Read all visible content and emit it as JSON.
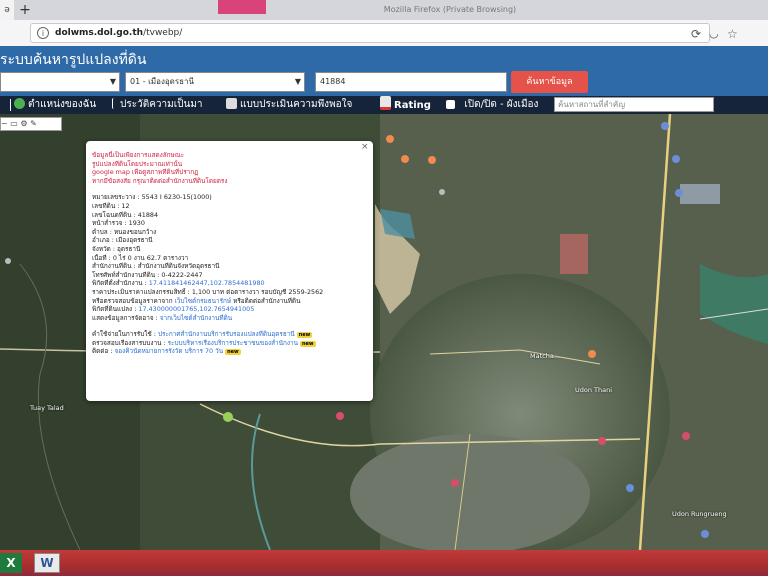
{
  "browser": {
    "tab_label": "ə",
    "new_tab_symbol": "+",
    "window_title": "Mozilla Firefox (Private Browsing)",
    "url_host": "dolwms.dol.go.th",
    "url_path": "/tvwebp/",
    "url_prefix": "",
    "icons": [
      "info-icon",
      "reload-icon",
      "pocket-icon",
      "star-icon"
    ]
  },
  "header": {
    "title": "ระบบค้นหารูปแปลงที่ดิน",
    "province_select": "",
    "district_select": "01 - เมืองอุดรธานี",
    "parcel_input": "41884",
    "search_button": "ค้นหาข้อมูล"
  },
  "nav": {
    "items": [
      {
        "label": "ตำแหน่งของฉัน",
        "icon": "globe-icon"
      },
      {
        "label": "ประวัติความเป็นมา",
        "icon": "history-icon"
      },
      {
        "label": "แบบประเมินความพึงพอใจ",
        "icon": "form-icon"
      },
      {
        "label": "Rating",
        "icon": "chart-icon"
      },
      {
        "label": "เปิด/ปิด - ผังเมือง",
        "icon": "layer-icon"
      }
    ],
    "place_placeholder": "ค้นหาสถานที่สำคัญ"
  },
  "map_toolbar": "~ ▭ ⚙ ✎",
  "map_labels": [
    "Tuay Talad",
    "Matcha...",
    "Udon Thani",
    "Udon Rungrueng"
  ],
  "popup": {
    "close": "×",
    "notice": [
      "ข้อมูลนี้เป็นเพียงการแสดงลักษณะ",
      "รูปแปลงที่ดินโดยประมาณเท่านั้น",
      "google map เพื่อดูสภาพที่ดินที่ปรากฏ",
      "หากมีข้อสงสัย กรุณาติดต่อสำนักงานที่ดินโดยตรง"
    ],
    "fields": [
      {
        "label": "หมายเลขระวาง",
        "value": "5543 I 6230-15(1000)"
      },
      {
        "label": "เลขที่ดิน",
        "value": "12"
      },
      {
        "label": "เลขโฉนดที่ดิน",
        "value": "41884"
      },
      {
        "label": "หน้าสำรวจ",
        "value": "1930"
      },
      {
        "label": "ตำบล",
        "value": "หนองขอนกว้าง"
      },
      {
        "label": "อำเภอ",
        "value": "เมืองอุดรธานี"
      },
      {
        "label": "จังหวัด",
        "value": "อุดรธานี"
      },
      {
        "label": "เนื้อที่",
        "value": "0 ไร่ 0 งาน 62.7 ตารางวา"
      },
      {
        "label": "สำนักงานที่ดิน",
        "value": "สำนักงานที่ดินจังหวัดอุดรธานี"
      },
      {
        "label": "โทรศัพท์สำนักงานที่ดิน",
        "value": "0-4222-2447"
      }
    ],
    "office_coords_label": "พิกัดที่ตั้งสำนักงาน",
    "office_coords": "17.411841462447,102.7854481980",
    "price_label": "ราคาประเมินราคาแปลงกรรมสิทธิ์",
    "price_value": "1,100 บาท ต่อตารางวา",
    "price_note": "รอบบัญชี 2559-2562",
    "price_note2": "หรือตรวจสอบข้อมูลราคาจาก",
    "price_link": "เว็บไซต์กรมธนารักษ์",
    "price_note3": "หรือติดต่อสำนักงานที่ดิน",
    "parcel_coords_label": "พิกัดที่ดินแปลง",
    "parcel_coords": "17.430000001765,102.7654941005",
    "mortgage_label": "แสดงข้อมูลการจัดอาจ",
    "mortgage_link": "จากเว็บไซต์สำนักงานที่ดิน",
    "services": [
      {
        "label": "คำใช้จ่ายในการรับใช้",
        "link": "ประกาศสำนักงานบริการรับรองแปลงที่ดินอุดรธานี",
        "badge": "new"
      },
      {
        "label": "ตรวจสอบเรื่องสารบบงาน",
        "link": "ระบบบริหารเรื่องบริการประชาชนของสำนักงาน",
        "badge": "new"
      },
      {
        "label": "ติดต่อ",
        "link": "จองคิวนัดหมายการรังวัด บริการ 70 วัน",
        "badge": "new"
      }
    ]
  },
  "taskbar": {
    "excel_letter": "X",
    "word_letter": "W"
  }
}
